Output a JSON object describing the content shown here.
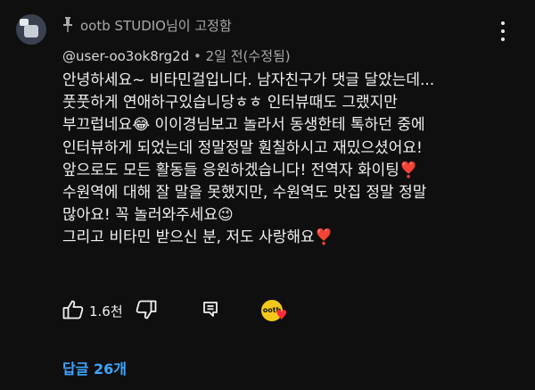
{
  "pinned": {
    "label": "ootb STUDIO님이 고정함"
  },
  "comment": {
    "author": "@user-oo3ok8rg2d",
    "separator": " • ",
    "time": "2일 전(수정됨)",
    "lines": [
      "안녕하세요~ 비타민걸입니다. 남자친구가 댓글 달았는데...",
      "풋풋하게 연애하구있습니당ㅎㅎ 인터뷰때도 그랬지만",
      "부끄럽네요😂 이이경님보고 놀라서 동생한테 톡하던 중에",
      "인터뷰하게 되었는데 정말정말 훤칠하시고 재밌으셨어요!",
      "앞으로도 모든 활동들 응원하겠습니다! 전역자 화이팅❣️",
      "수원역에 대해 잘 말을 못했지만, 수원역도 맛집 정말 정말",
      "많아요! 꼭 놀러와주세요😉",
      "그리고 비타민 받으신 분, 저도 사랑해요❣️"
    ]
  },
  "actions": {
    "like_count": "1.6천",
    "creator_avatar_text": "ootb",
    "creator_heart": "♥"
  },
  "replies": {
    "label": "답글 26개"
  },
  "icons": {
    "pin": "pin-icon",
    "more": "more-vert-icon",
    "like": "thumb-up-icon",
    "dislike": "thumb-down-icon",
    "reply": "reply-icon",
    "heart": "heart-icon"
  },
  "colors": {
    "background": "#0f0f0f",
    "link": "#3ea6ff",
    "heart": "#ff2a3a"
  }
}
